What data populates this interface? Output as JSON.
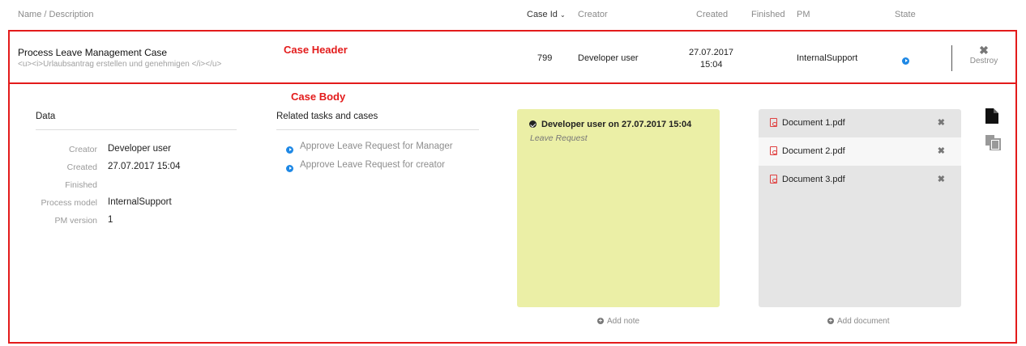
{
  "columns": {
    "name": "Name / Description",
    "case_id": "Case Id",
    "creator": "Creator",
    "created": "Created",
    "finished": "Finished",
    "pm": "PM",
    "state": "State"
  },
  "case": {
    "title": "Process Leave Management Case",
    "description": "<u><i>Urlaubsantrag erstellen und genehmigen </i></u>",
    "id": "799",
    "creator": "Developer user",
    "created_date": "27.07.2017",
    "created_time": "15:04",
    "pm": "InternalSupport",
    "state_icon": "play-circle-icon",
    "destroy_label": "Destroy"
  },
  "annotations": {
    "header": "Case Header",
    "body": "Case Body"
  },
  "data_section": {
    "title": "Data",
    "rows": [
      {
        "label": "Creator",
        "value": "Developer user"
      },
      {
        "label": "Created",
        "value": "27.07.2017 15:04"
      },
      {
        "label": "Finished",
        "value": ""
      },
      {
        "label": "Process model",
        "value": "InternalSupport"
      },
      {
        "label": "PM version",
        "value": "1"
      }
    ]
  },
  "related": {
    "title": "Related tasks and cases",
    "items": [
      "Approve Leave Request for Manager",
      "Approve Leave Request for creator"
    ]
  },
  "note": {
    "author_line": "Developer user on 27.07.2017 15:04",
    "text": "Leave Request",
    "add_label": "Add note"
  },
  "documents": {
    "items": [
      "Document 1.pdf",
      "Document 2.pdf",
      "Document 3.pdf"
    ],
    "add_label": "Add document"
  },
  "colors": {
    "annotation_red": "#e31b1b",
    "note_bg": "#ebefa6",
    "doc_panel_bg": "#e5e5e5",
    "play_blue": "#1e88e5"
  }
}
